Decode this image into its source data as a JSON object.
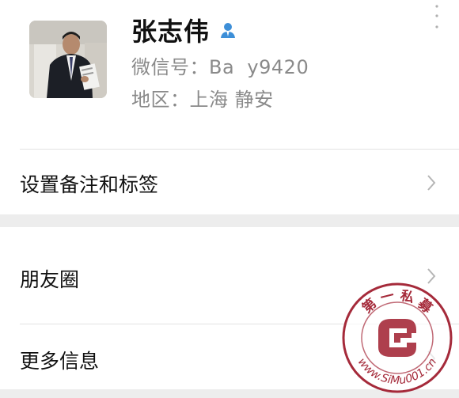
{
  "profile": {
    "name": "张志伟",
    "wechat_id_label": "微信号：",
    "wechat_id_value": "Ba  y9420",
    "region_label": "地区：",
    "region_value": "上海 静安",
    "verified_icon": "contact-person-icon"
  },
  "menu": {
    "remark_tags": "设置备注和标签",
    "moments": "朋友圈",
    "more_info": "更多信息"
  },
  "watermark": {
    "top_text": "第 一 私 募",
    "bottom_text": "www.SiMu001.cn",
    "color": "#a52a3a"
  },
  "colors": {
    "background_gap": "#ededed",
    "secondary_text": "#8a8a8a",
    "accent_icon": "#3d8fd8"
  }
}
